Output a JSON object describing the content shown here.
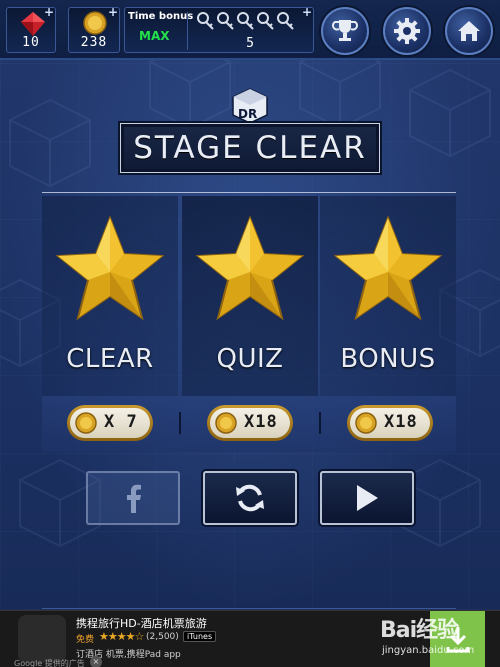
{
  "topbar": {
    "gems": "10",
    "coins": "238",
    "time_bonus_label": "Time bonus",
    "time_bonus_value": "MAX",
    "keys_count": "5",
    "plus_symbol": "+",
    "icons": [
      "gem-icon",
      "coin-icon",
      "key-icon",
      "trophy-icon",
      "gear-icon",
      "home-icon"
    ]
  },
  "title": "STAGE CLEAR",
  "logo_text": "DR",
  "panels": [
    {
      "label": "CLEAR",
      "reward": "X 7"
    },
    {
      "label": "QUIZ",
      "reward": "X18"
    },
    {
      "label": "BONUS",
      "reward": "X18"
    }
  ],
  "actions": {
    "facebook_icon": "facebook-icon",
    "replay_icon": "replay-icon",
    "next_icon": "play-icon"
  },
  "ad": {
    "title": "携程旅行HD-酒店机票旅游",
    "free": "免费",
    "stars": "★★★★☆",
    "rating": "(2,500)",
    "store": "iTunes",
    "description": "订酒店 机票,携程Pad app",
    "google_label": "Google 提供的广告",
    "close": "×"
  },
  "watermark": {
    "text": "Bai经验",
    "url": "jingyan.baidu.com"
  },
  "colors": {
    "accent_gold": "#f2c230",
    "max_green": "#22e04a",
    "background": "#1f3568"
  }
}
